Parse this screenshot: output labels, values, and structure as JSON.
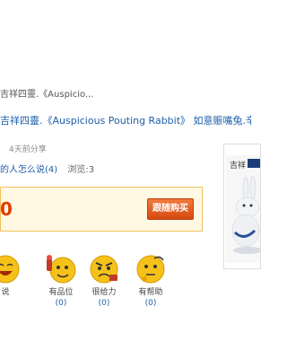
{
  "breadcrumb": "吉祥四靈.《Auspicio...",
  "title": "吉祥四靈.《Auspicious Pouting Rabbit》 如意賑嘴兔.辛卯年",
  "share_time": "4天前分享",
  "comments": {
    "link_text": "的人怎么说(4)",
    "views_text": "浏览:3"
  },
  "price": {
    "value": "0",
    "color": "#e33b00"
  },
  "buy_button": {
    "label": "跟随购买"
  },
  "product": {
    "image_text": "吉祥",
    "icon": "rabbit-figurine-image"
  },
  "votes": [
    {
      "label": "说",
      "count": "",
      "icon": "laughing-face-icon"
    },
    {
      "label": "有品位",
      "count": "(0)",
      "icon": "cheering-face-icon"
    },
    {
      "label": "很给力",
      "count": "(0)",
      "icon": "angry-face-icon"
    },
    {
      "label": "有帮助",
      "count": "(0)",
      "icon": "thinking-face-icon"
    }
  ],
  "colors": {
    "link": "#1d5fa8",
    "price_box_bg": "#fff9e4",
    "button": "#e05a1c"
  }
}
